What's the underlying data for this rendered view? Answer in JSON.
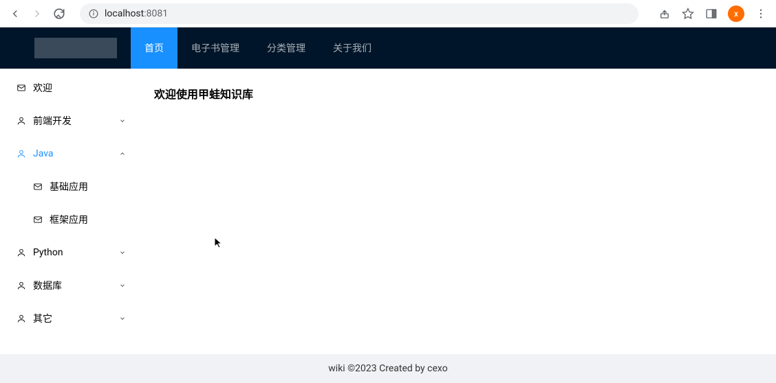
{
  "browser": {
    "url_host": "localhost",
    "url_port": ":8081",
    "avatar_letter": "x"
  },
  "header": {
    "nav": [
      {
        "label": "首页",
        "active": true
      },
      {
        "label": "电子书管理",
        "active": false
      },
      {
        "label": "分类管理",
        "active": false
      },
      {
        "label": "关于我们",
        "active": false
      }
    ]
  },
  "sidebar": {
    "items": [
      {
        "label": "欢迎",
        "type": "leaf",
        "icon": "mail"
      },
      {
        "label": "前端开发",
        "type": "branch",
        "icon": "user",
        "expanded": false
      },
      {
        "label": "Java",
        "type": "branch",
        "icon": "user",
        "expanded": true,
        "selected": true,
        "children": [
          {
            "label": "基础应用",
            "icon": "mail"
          },
          {
            "label": "框架应用",
            "icon": "mail"
          }
        ]
      },
      {
        "label": "Python",
        "type": "branch",
        "icon": "user",
        "expanded": false
      },
      {
        "label": "数据库",
        "type": "branch",
        "icon": "user",
        "expanded": false
      },
      {
        "label": "其它",
        "type": "branch",
        "icon": "user",
        "expanded": false
      }
    ]
  },
  "main": {
    "welcome": "欢迎使用甲蛙知识库"
  },
  "footer": {
    "text": "wiki ©2023 Created by cexo"
  }
}
